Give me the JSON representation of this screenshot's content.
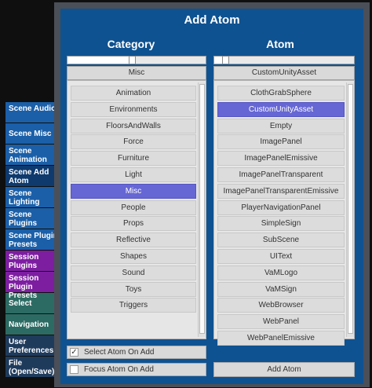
{
  "tabs": [
    {
      "label": "Scene Audio",
      "style": "blue"
    },
    {
      "label": "Scene Misc",
      "style": "blue"
    },
    {
      "label": "Scene Animation",
      "style": "blue"
    },
    {
      "label": "Scene Add Atom",
      "style": "active"
    },
    {
      "label": "Scene Lighting",
      "style": "blue"
    },
    {
      "label": "Scene Plugins",
      "style": "blue"
    },
    {
      "label": "Scene Plugin Presets",
      "style": "blue"
    },
    {
      "label": "Session Plugins",
      "style": "purple"
    },
    {
      "label": "Session Plugin Presets",
      "style": "purple"
    },
    {
      "label": "Select",
      "style": "teal"
    },
    {
      "label": "Navigation",
      "style": "teal"
    },
    {
      "label": "User Preferences",
      "style": "navy"
    },
    {
      "label": "File (Open/Save)",
      "style": "navy"
    }
  ],
  "panel": {
    "title": "Add Atom",
    "category": {
      "header": "Category",
      "selected": "Misc",
      "items": [
        "Animation",
        "Environments",
        "FloorsAndWalls",
        "Force",
        "Furniture",
        "Light",
        "Misc",
        "People",
        "Props",
        "Reflective",
        "Shapes",
        "Sound",
        "Toys",
        "Triggers"
      ],
      "selected_index": 6
    },
    "atom": {
      "header": "Atom",
      "selected": "CustomUnityAsset",
      "items": [
        "ClothGrabSphere",
        "CustomUnityAsset",
        "Empty",
        "ImagePanel",
        "ImagePanelEmissive",
        "ImagePanelTransparent",
        "ImagePanelTransparentEmissive",
        "PlayerNavigationPanel",
        "SimpleSign",
        "SubScene",
        "UIText",
        "VaMLogo",
        "VaMSign",
        "WebBrowser",
        "WebPanel",
        "WebPanelEmissive"
      ],
      "selected_index": 1
    },
    "select_atom_on_add": {
      "label": "Select Atom On Add",
      "checked": true
    },
    "focus_atom_on_add": {
      "label": "Focus Atom On Add",
      "checked": false
    },
    "add_button": "Add Atom"
  }
}
